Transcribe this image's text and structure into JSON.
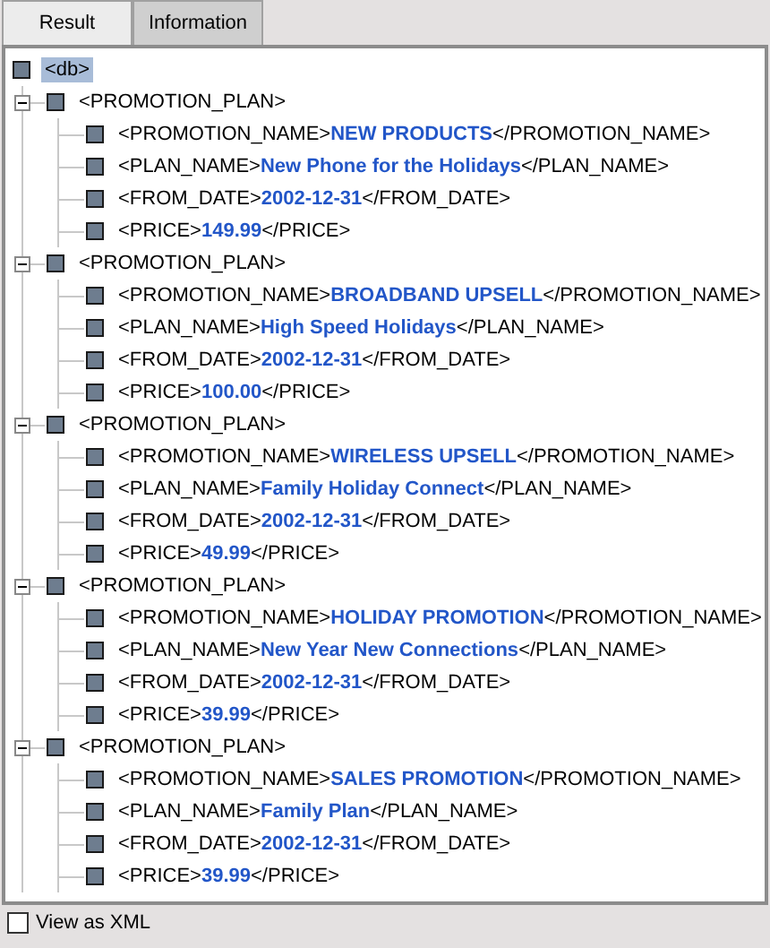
{
  "tabs": [
    {
      "label": "Result",
      "selected": true
    },
    {
      "label": "Information",
      "selected": false
    }
  ],
  "tree": {
    "label": "<db>",
    "selected": true,
    "children": [
      {
        "label": "<PROMOTION_PLAN>",
        "expanded": true,
        "children": [
          {
            "label": "<PROMOTION_NAME>**NEW PRODUCTS**</PROMOTION_NAME>"
          },
          {
            "label": "<PLAN_NAME>**New Phone for the Holidays**</PLAN_NAME>"
          },
          {
            "label": "<FROM_DATE>**2002-12-31**</FROM_DATE>"
          },
          {
            "label": "<PRICE>**149.99**</PRICE>"
          }
        ]
      },
      {
        "label": "<PROMOTION_PLAN>",
        "expanded": true,
        "children": [
          {
            "label": "<PROMOTION_NAME>**BROADBAND UPSELL**</PROMOTION_NAME>"
          },
          {
            "label": "<PLAN_NAME>**High Speed Holidays**</PLAN_NAME>"
          },
          {
            "label": "<FROM_DATE>**2002-12-31**</FROM_DATE>"
          },
          {
            "label": "<PRICE>**100.00**</PRICE>"
          }
        ]
      },
      {
        "label": "<PROMOTION_PLAN>",
        "expanded": true,
        "children": [
          {
            "label": "<PROMOTION_NAME>**WIRELESS UPSELL**</PROMOTION_NAME>"
          },
          {
            "label": "<PLAN_NAME>**Family Holiday Connect**</PLAN_NAME>"
          },
          {
            "label": "<FROM_DATE>**2002-12-31**</FROM_DATE>"
          },
          {
            "label": "<PRICE>**49.99**</PRICE>"
          }
        ]
      },
      {
        "label": "<PROMOTION_PLAN>",
        "expanded": true,
        "children": [
          {
            "label": "<PROMOTION_NAME>**HOLIDAY PROMOTION**</PROMOTION_NAME>"
          },
          {
            "label": "<PLAN_NAME>**New Year New Connections**</PLAN_NAME>"
          },
          {
            "label": "<FROM_DATE>**2002-12-31**</FROM_DATE>"
          },
          {
            "label": "<PRICE>**39.99**</PRICE>"
          }
        ]
      },
      {
        "label": "<PROMOTION_PLAN>",
        "expanded": true,
        "children": [
          {
            "label": "<PROMOTION_NAME>**SALES PROMOTION**</PROMOTION_NAME>"
          },
          {
            "label": "<PLAN_NAME>**Family Plan**</PLAN_NAME>"
          },
          {
            "label": "<FROM_DATE>**2002-12-31**</FROM_DATE>"
          },
          {
            "label": "<PRICE>**39.99**</PRICE>"
          }
        ]
      }
    ]
  },
  "view_as_xml": {
    "label": "View as XML",
    "checked": false
  }
}
